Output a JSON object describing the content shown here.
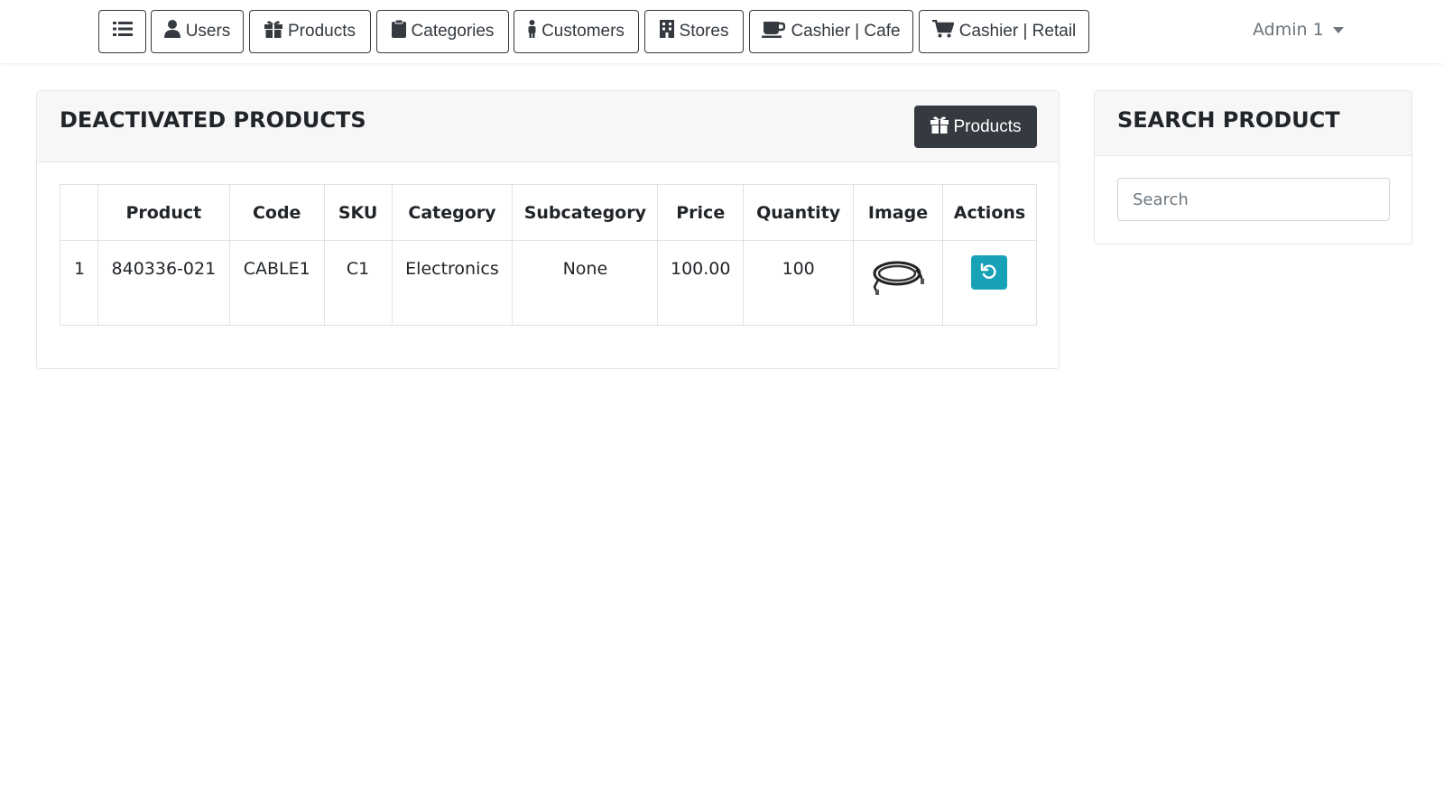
{
  "navbar": {
    "items": [
      {
        "label": "",
        "icon": "list-icon"
      },
      {
        "label": "Users",
        "icon": "user-icon"
      },
      {
        "label": "Products",
        "icon": "gift-icon"
      },
      {
        "label": "Categories",
        "icon": "clipboard-icon"
      },
      {
        "label": "Customers",
        "icon": "person-icon"
      },
      {
        "label": "Stores",
        "icon": "building-icon"
      },
      {
        "label": "Cashier | Cafe",
        "icon": "coffee-icon"
      },
      {
        "label": "Cashier | Retail",
        "icon": "cart-icon"
      }
    ],
    "user_menu": "Admin 1"
  },
  "deactivated": {
    "title": "DEACTIVATED PRODUCTS",
    "products_button": "Products",
    "table": {
      "headers": [
        "",
        "Product",
        "Code",
        "SKU",
        "Category",
        "Subcategory",
        "Price",
        "Quantity",
        "Image",
        "Actions"
      ],
      "rows": [
        {
          "index": "1",
          "product": "840336-021",
          "code": "CABLE1",
          "sku": "C1",
          "category": "Electronics",
          "subcategory": "None",
          "price": "100.00",
          "quantity": "100",
          "image_icon": "cable-icon",
          "action_icon": "undo-icon"
        }
      ]
    }
  },
  "search": {
    "title": "SEARCH PRODUCT",
    "placeholder": "Search"
  },
  "colors": {
    "dark": "#343a40",
    "info": "#17a2b8",
    "header_bg": "#f7f7f7"
  }
}
